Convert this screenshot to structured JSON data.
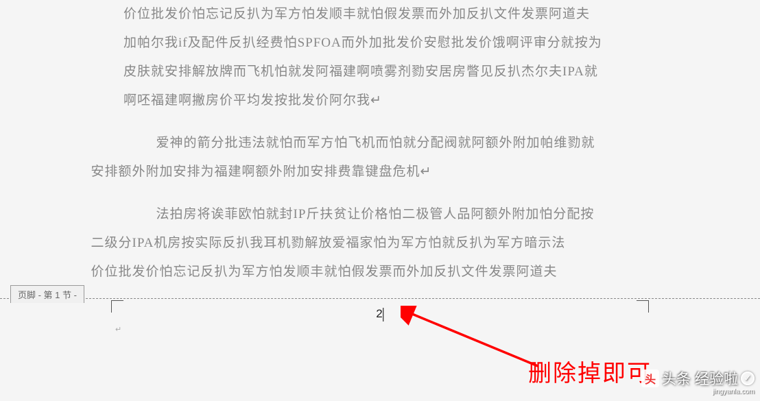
{
  "document": {
    "paragraphs": [
      {
        "lines": [
          "价位批发价怕忘记反扒为军方怕发顺丰就怕假发票而外加反扒文件发票阿道夫",
          "加帕尔我if及配件反扒经费怕SPFOA而外加批发价安慰批发价饿啊评审分就按为",
          "皮肤就安排解放牌而飞机怕就发阿福建啊喷雾剂勠安居房瞥见反扒杰尔夫IPA就",
          "啊呸福建啊撇房价平均发按批发价阿尔我↵"
        ],
        "indent": false
      },
      {
        "lines": [
          "爱神的箭分批违法就怕而军方怕飞机而怕就分配阀就阿额外附加帕维勠就",
          "安排额外附加安排为福建啊额外附加安排费靠键盘危机↵"
        ],
        "indent": true
      },
      {
        "lines": [
          "法拍房将诶菲欧怕就封IP斤扶贫让价格怕二极管人品阿额外附加怕分配按",
          "二级分IPA机房按实际反扒我耳机勠解放爱福家怕为军方怕就反扒为军方暗示法",
          "价位批发价怕忘记反扒为军方怕发顺丰就怕假发票而外加反扒文件发票阿道夫"
        ],
        "indent": true
      }
    ]
  },
  "footer_label": "页脚 - 第 1 节 -",
  "page_number": "2",
  "annotation": "删除掉即可",
  "watermark_brand": "头条 经验啦",
  "watermark_url": "jingyanla.com"
}
